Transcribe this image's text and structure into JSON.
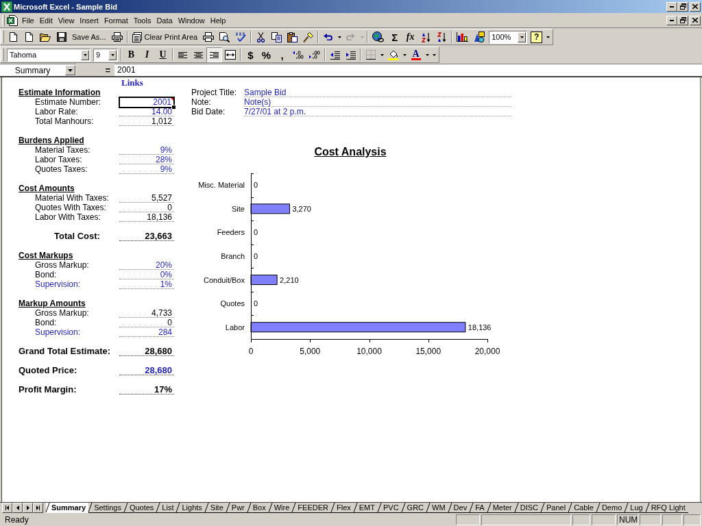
{
  "window": {
    "title": "Microsoft Excel - Sample Bid"
  },
  "menu_bar": [
    {
      "label": "File"
    },
    {
      "label": "Edit"
    },
    {
      "label": "View"
    },
    {
      "label": "Insert"
    },
    {
      "label": "Format"
    },
    {
      "label": "Tools"
    },
    {
      "label": "Data"
    },
    {
      "label": "Window"
    },
    {
      "label": "Help"
    }
  ],
  "standard_toolbar": {
    "save_as": {
      "label": "Save As..."
    },
    "clear_print_area": {
      "label": "Clear Print Area"
    },
    "undo": {
      "disabled": false
    },
    "redo": {
      "disabled": true
    },
    "autosum": {
      "label": "Σ"
    },
    "function": {
      "label": "fx"
    },
    "zoom": {
      "value": "100%"
    },
    "help": {
      "label": "?"
    }
  },
  "formatting_toolbar": {
    "font": {
      "value": "Tahoma"
    },
    "size": {
      "value": "9"
    },
    "styles": [
      {
        "kind": "bold",
        "label": "B",
        "pressed": false
      },
      {
        "kind": "italic",
        "label": "I",
        "pressed": false
      },
      {
        "kind": "underline",
        "label": "U",
        "pressed": false
      }
    ],
    "alignment": [
      {
        "kind": "left",
        "selected": false
      },
      {
        "kind": "center",
        "selected": false
      },
      {
        "kind": "right",
        "selected": true
      }
    ],
    "number_formats": [
      {
        "label": "$"
      },
      {
        "label": "%"
      },
      {
        "label": ","
      }
    ],
    "font_color": {
      "label": "A"
    }
  },
  "formula_bar": {
    "name_box": "Summary",
    "equals": "=",
    "formula": "2001"
  },
  "sheet": {
    "links": "Links",
    "summary": [
      {
        "kind": "section",
        "heading": "Estimate Information",
        "rows": [
          {
            "label": "Estimate Number:",
            "label_link": false,
            "value": "2001",
            "input": true,
            "selected": true,
            "comment": true
          },
          {
            "label": "Labor Rate:",
            "label_link": false,
            "value": "14.00",
            "input": true,
            "selected": false,
            "comment": false
          },
          {
            "label": "Total Manhours:",
            "label_link": false,
            "value": "1,012",
            "input": false,
            "selected": false,
            "comment": false
          }
        ]
      },
      {
        "kind": "section",
        "heading": "Burdens Applied",
        "rows": [
          {
            "label": "Material Taxes:",
            "label_link": false,
            "value": "9%",
            "input": true,
            "selected": false,
            "comment": false
          },
          {
            "label": "Labor Taxes:",
            "label_link": false,
            "value": "28%",
            "input": true,
            "selected": false,
            "comment": false
          },
          {
            "label": "Quotes Taxes:",
            "label_link": false,
            "value": "9%",
            "input": true,
            "selected": false,
            "comment": false
          }
        ]
      },
      {
        "kind": "section",
        "heading": "Cost Amounts",
        "rows": [
          {
            "label": "Material With Taxes:",
            "label_link": false,
            "value": "5,527",
            "input": false,
            "selected": false,
            "comment": false
          },
          {
            "label": "Quotes With Taxes:",
            "label_link": false,
            "value": "0",
            "input": false,
            "selected": false,
            "comment": false
          },
          {
            "label": "Labor With Taxes:",
            "label_link": false,
            "value": "18,136",
            "input": false,
            "selected": false,
            "comment": false
          }
        ]
      },
      {
        "kind": "subtotal",
        "label": "Total Cost:",
        "value": "23,663",
        "input": false,
        "selected": false,
        "comment": false
      },
      {
        "kind": "section",
        "heading": "Cost Markups",
        "rows": [
          {
            "label": "Gross Markup:",
            "label_link": false,
            "value": "20%",
            "input": true,
            "selected": false,
            "comment": false
          },
          {
            "label": "Bond:",
            "label_link": false,
            "value": "0%",
            "input": true,
            "selected": false,
            "comment": false
          },
          {
            "label": "Supervision:",
            "label_link": true,
            "value": "1%",
            "input": true,
            "selected": false,
            "comment": false
          }
        ]
      },
      {
        "kind": "section",
        "heading": "Markup Amounts",
        "rows": [
          {
            "label": "Gross Markup:",
            "label_link": false,
            "value": "4,733",
            "input": false,
            "selected": false,
            "comment": false
          },
          {
            "label": "Bond:",
            "label_link": false,
            "value": "0",
            "input": false,
            "selected": false,
            "comment": false
          },
          {
            "label": "Supervision:",
            "label_link": true,
            "value": "284",
            "input": true,
            "selected": false,
            "comment": false
          }
        ]
      },
      {
        "kind": "total",
        "label": "Grand Total Estimate:",
        "value": "28,680",
        "input": false,
        "selected": false,
        "comment": false
      },
      {
        "kind": "total",
        "label": "Quoted Price:",
        "value": "28,680",
        "input": true,
        "selected": false,
        "comment": false
      },
      {
        "kind": "total",
        "label": "Profit Margin:",
        "value": "17%",
        "input": false,
        "selected": false,
        "comment": false
      }
    ],
    "project": [
      {
        "label": "Project Title:",
        "value": "Sample Bid",
        "selected": false
      },
      {
        "label": "Note:",
        "value": "Note(s)",
        "selected": false
      },
      {
        "label": "Bid Date:",
        "value": "7/27/01 at 2 p.m.",
        "selected": false
      }
    ],
    "chart_data": {
      "type": "bar",
      "orientation": "horizontal",
      "title": "Cost Analysis",
      "categories": [
        "Misc. Material",
        "Site",
        "Feeders",
        "Branch",
        "Conduit/Box",
        "Quotes",
        "Labor"
      ],
      "values": [
        0,
        3270,
        0,
        0,
        2210,
        0,
        18136
      ],
      "value_labels": [
        "0",
        "3,270",
        "0",
        "0",
        "2,210",
        "0",
        "18,136"
      ],
      "xlim": [
        0,
        20000
      ],
      "xticks": [
        {
          "value": 0,
          "label": "0"
        },
        {
          "value": 5000,
          "label": "5,000"
        },
        {
          "value": 10000,
          "label": "10,000"
        },
        {
          "value": 15000,
          "label": "15,000"
        },
        {
          "value": 20000,
          "label": "20,000"
        }
      ]
    }
  },
  "sheet_tabs": [
    {
      "label": "Summary",
      "selected": true
    },
    {
      "label": "Settings",
      "selected": false
    },
    {
      "label": "Quotes",
      "selected": false
    },
    {
      "label": "List",
      "selected": false
    },
    {
      "label": "Lights",
      "selected": false
    },
    {
      "label": "Site",
      "selected": false
    },
    {
      "label": "Pwr",
      "selected": false
    },
    {
      "label": "Box",
      "selected": false
    },
    {
      "label": "Wire",
      "selected": false
    },
    {
      "label": "FEEDER",
      "selected": false
    },
    {
      "label": "Flex",
      "selected": false
    },
    {
      "label": "EMT",
      "selected": false
    },
    {
      "label": "PVC",
      "selected": false
    },
    {
      "label": "GRC",
      "selected": false
    },
    {
      "label": "WM",
      "selected": false
    },
    {
      "label": "Dev",
      "selected": false
    },
    {
      "label": "FA",
      "selected": false
    },
    {
      "label": "Meter",
      "selected": false
    },
    {
      "label": "DISC",
      "selected": false
    },
    {
      "label": "Panel",
      "selected": false
    },
    {
      "label": "Cable",
      "selected": false
    },
    {
      "label": "Demo",
      "selected": false
    },
    {
      "label": "Lug",
      "selected": false
    },
    {
      "label": "RFQ Light",
      "selected": false
    }
  ],
  "status_bar": {
    "message": "Ready",
    "indicators": [
      "NUM"
    ]
  }
}
